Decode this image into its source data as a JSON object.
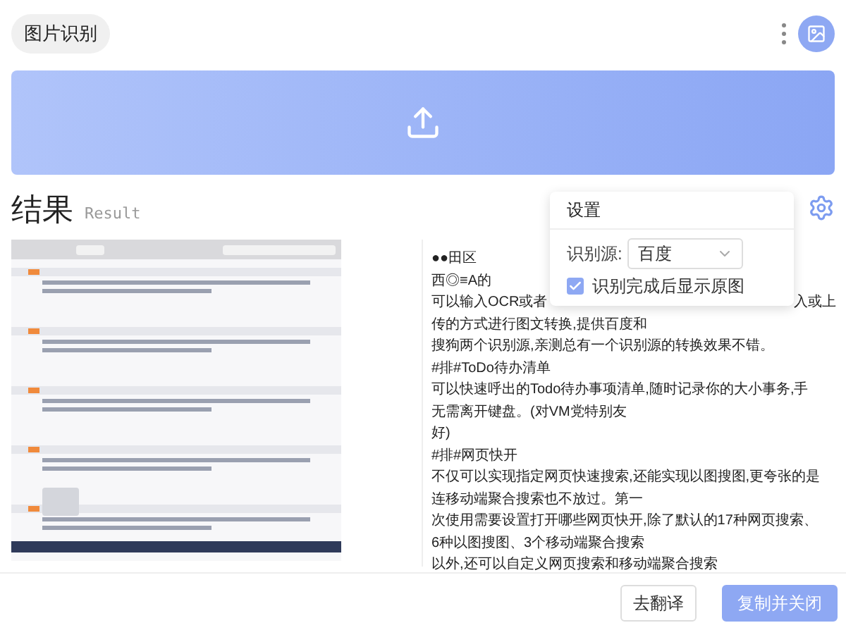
{
  "header": {
    "title": "图片识别"
  },
  "result": {
    "title": "结果",
    "subtitle": "Result",
    "lines": [
      {
        "text": "●●田区"
      },
      {
        "text": "西◎≡A的"
      },
      {
        "text": "可以输入OCR或者",
        "tail": "入或上"
      },
      {
        "text": "传的方式进行图文转换,提供百度和"
      },
      {
        "text": "搜狗两个识别源,亲测总有一个识别源的转换效果不错。"
      },
      {
        "text": "#排#ToDo待办清单"
      },
      {
        "text": "可以快速呼出的Todo待办事项清单,随时记录你的大小事务,手"
      },
      {
        "text": "无需离开键盘。(对VM党特别友"
      },
      {
        "text": "好)"
      },
      {
        "text": "#排#网页快开"
      },
      {
        "text": "不仅可以实现指定网页快速搜索,还能实现以图搜图,更夸张的是"
      },
      {
        "text": "连移动端聚合搜索也不放过。第一"
      },
      {
        "text": "次使用需要设置打开哪些网页快开,除了默认的17种网页搜索、"
      },
      {
        "text": "6种以图搜图、3个移动端聚合搜索"
      },
      {
        "text": "以外,还可以自定义网页搜索和移动端聚合搜索"
      }
    ]
  },
  "settings": {
    "title": "设置",
    "source_label": "识别源:",
    "source_value": "百度",
    "show_original": {
      "label": "识别完成后显示原图",
      "checked": true
    }
  },
  "buttons": [
    {
      "label": "去翻译",
      "kind": "secondary"
    },
    {
      "label": "复制并关闭",
      "kind": "primary"
    }
  ]
}
